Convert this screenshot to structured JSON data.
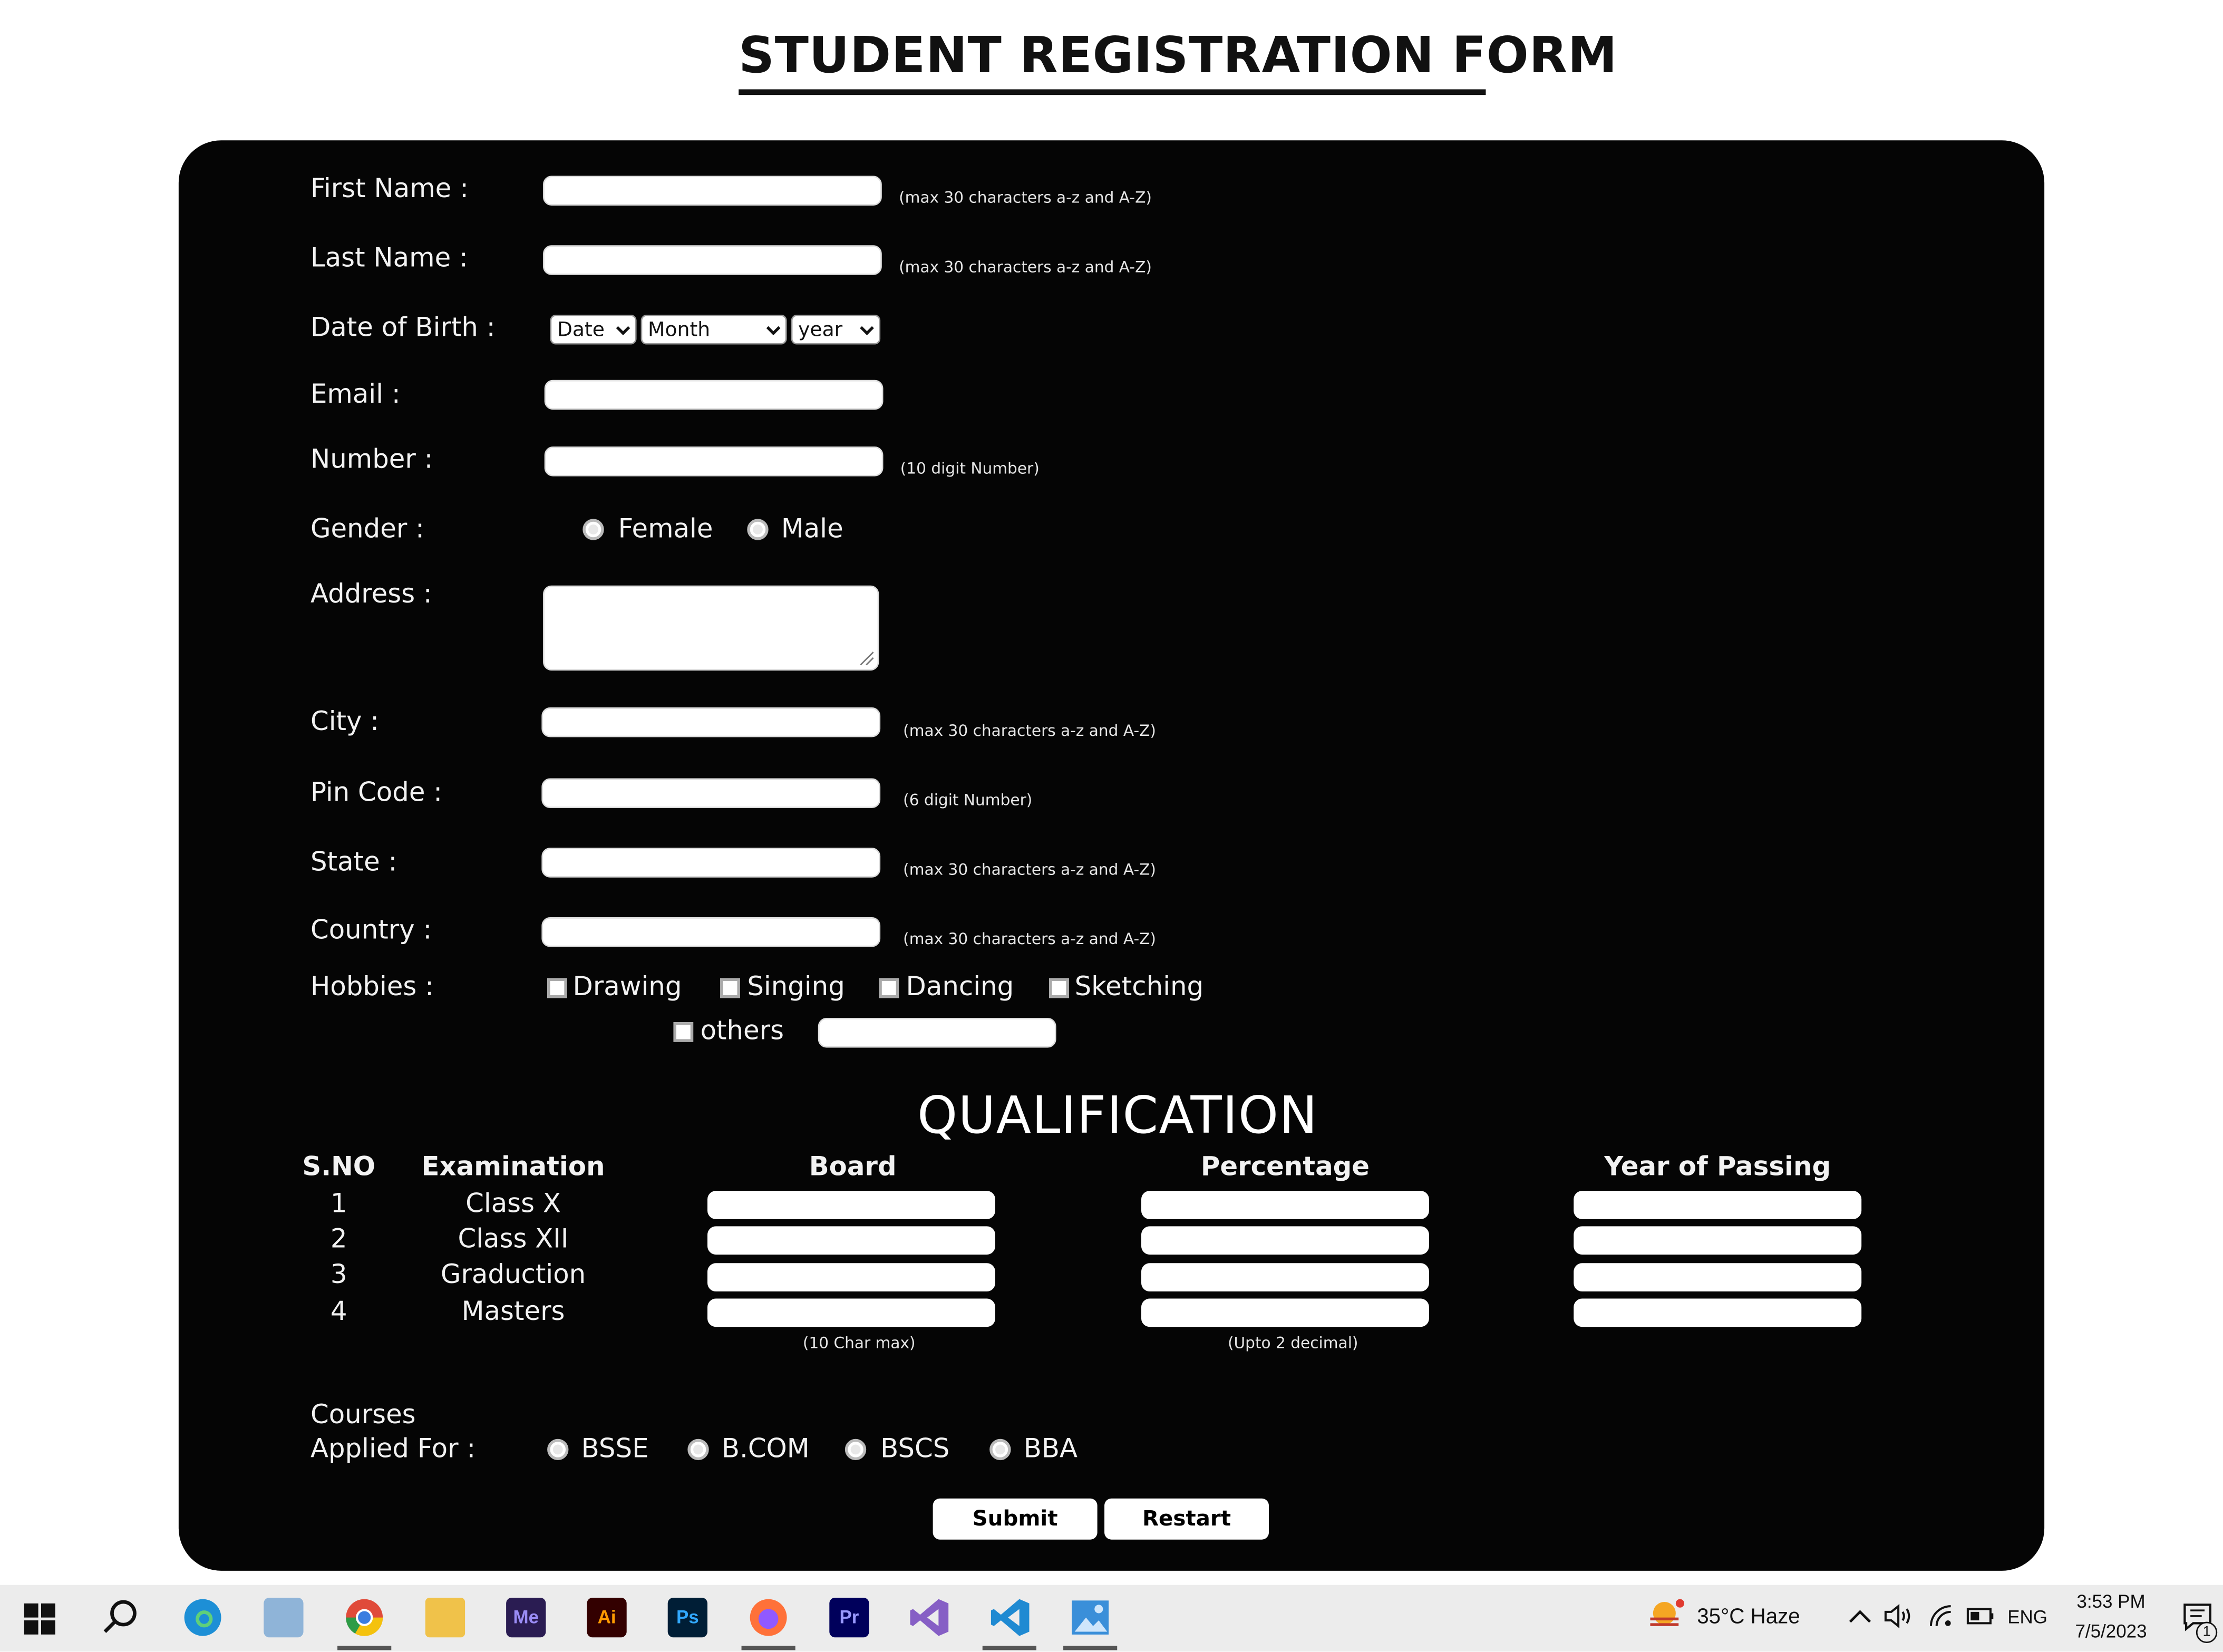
{
  "page": {
    "title": "STUDENT REGISTRATION FORM"
  },
  "form": {
    "first_name": {
      "label": "First Name :",
      "hint": "(max 30 characters a-z and A-Z)"
    },
    "last_name": {
      "label": "Last Name :",
      "hint": "(max 30 characters a-z and A-Z)"
    },
    "dob": {
      "label": "Date of Birth :",
      "date": "Date",
      "month": "Month",
      "year": "year"
    },
    "email": {
      "label": "Email :"
    },
    "number": {
      "label": "Number :",
      "hint": "(10 digit Number)"
    },
    "gender": {
      "label": "Gender :",
      "options": [
        "Female",
        "Male"
      ]
    },
    "address": {
      "label": "Address :"
    },
    "city": {
      "label": "City :",
      "hint": "(max 30 characters a-z and A-Z)"
    },
    "pin": {
      "label": "Pin Code :",
      "hint": "(6 digit Number)"
    },
    "state": {
      "label": "State :",
      "hint": "(max 30 characters a-z and A-Z)"
    },
    "country": {
      "label": "Country :",
      "hint": "(max 30 characters a-z and A-Z)"
    },
    "hobbies": {
      "label": "Hobbies :",
      "options": [
        "Drawing",
        "Singing",
        "Dancing",
        "Sketching",
        "others"
      ]
    }
  },
  "qualification": {
    "heading": "QUALIFICATION",
    "columns": [
      "S.NO",
      "Examination",
      "Board",
      "Percentage",
      "Year of Passing"
    ],
    "rows": [
      {
        "sno": "1",
        "exam": "Class X"
      },
      {
        "sno": "2",
        "exam": "Class XII"
      },
      {
        "sno": "3",
        "exam": "Graduction"
      },
      {
        "sno": "4",
        "exam": "Masters"
      }
    ],
    "board_hint": "(10 Char max)",
    "percentage_hint": "(Upto 2 decimal)"
  },
  "courses": {
    "label_line1": "Courses",
    "label_line2": "Applied For :",
    "options": [
      "BSSE",
      "B.COM",
      "BSCS",
      "BBA"
    ]
  },
  "buttons": {
    "submit": "Submit",
    "restart": "Restart"
  },
  "taskbar": {
    "apps": [
      {
        "name": "start",
        "icon": "windows-icon"
      },
      {
        "name": "search",
        "icon": "search-icon"
      },
      {
        "name": "edge",
        "icon": "edge-icon"
      },
      {
        "name": "file-manager",
        "icon": "computer-icon"
      },
      {
        "name": "chrome",
        "icon": "chrome-icon"
      },
      {
        "name": "explorer",
        "icon": "folder-icon"
      },
      {
        "name": "media-encoder",
        "icon": "media-encoder-icon",
        "text": "Me"
      },
      {
        "name": "illustrator",
        "icon": "illustrator-icon",
        "text": "Ai"
      },
      {
        "name": "photoshop",
        "icon": "photoshop-icon",
        "text": "Ps"
      },
      {
        "name": "firefox",
        "icon": "firefox-icon"
      },
      {
        "name": "premiere",
        "icon": "premiere-icon",
        "text": "Pr"
      },
      {
        "name": "visual-studio",
        "icon": "visual-studio-icon"
      },
      {
        "name": "vscode",
        "icon": "vscode-icon"
      },
      {
        "name": "photos",
        "icon": "photos-icon"
      }
    ],
    "weather": "35°C  Haze",
    "language": "ENG",
    "time": "3:53 PM",
    "date": "7/5/2023",
    "notification_count": "1"
  },
  "colors": {
    "panel": "#050505",
    "page": "#ffffff",
    "taskbar": "#ececec"
  }
}
